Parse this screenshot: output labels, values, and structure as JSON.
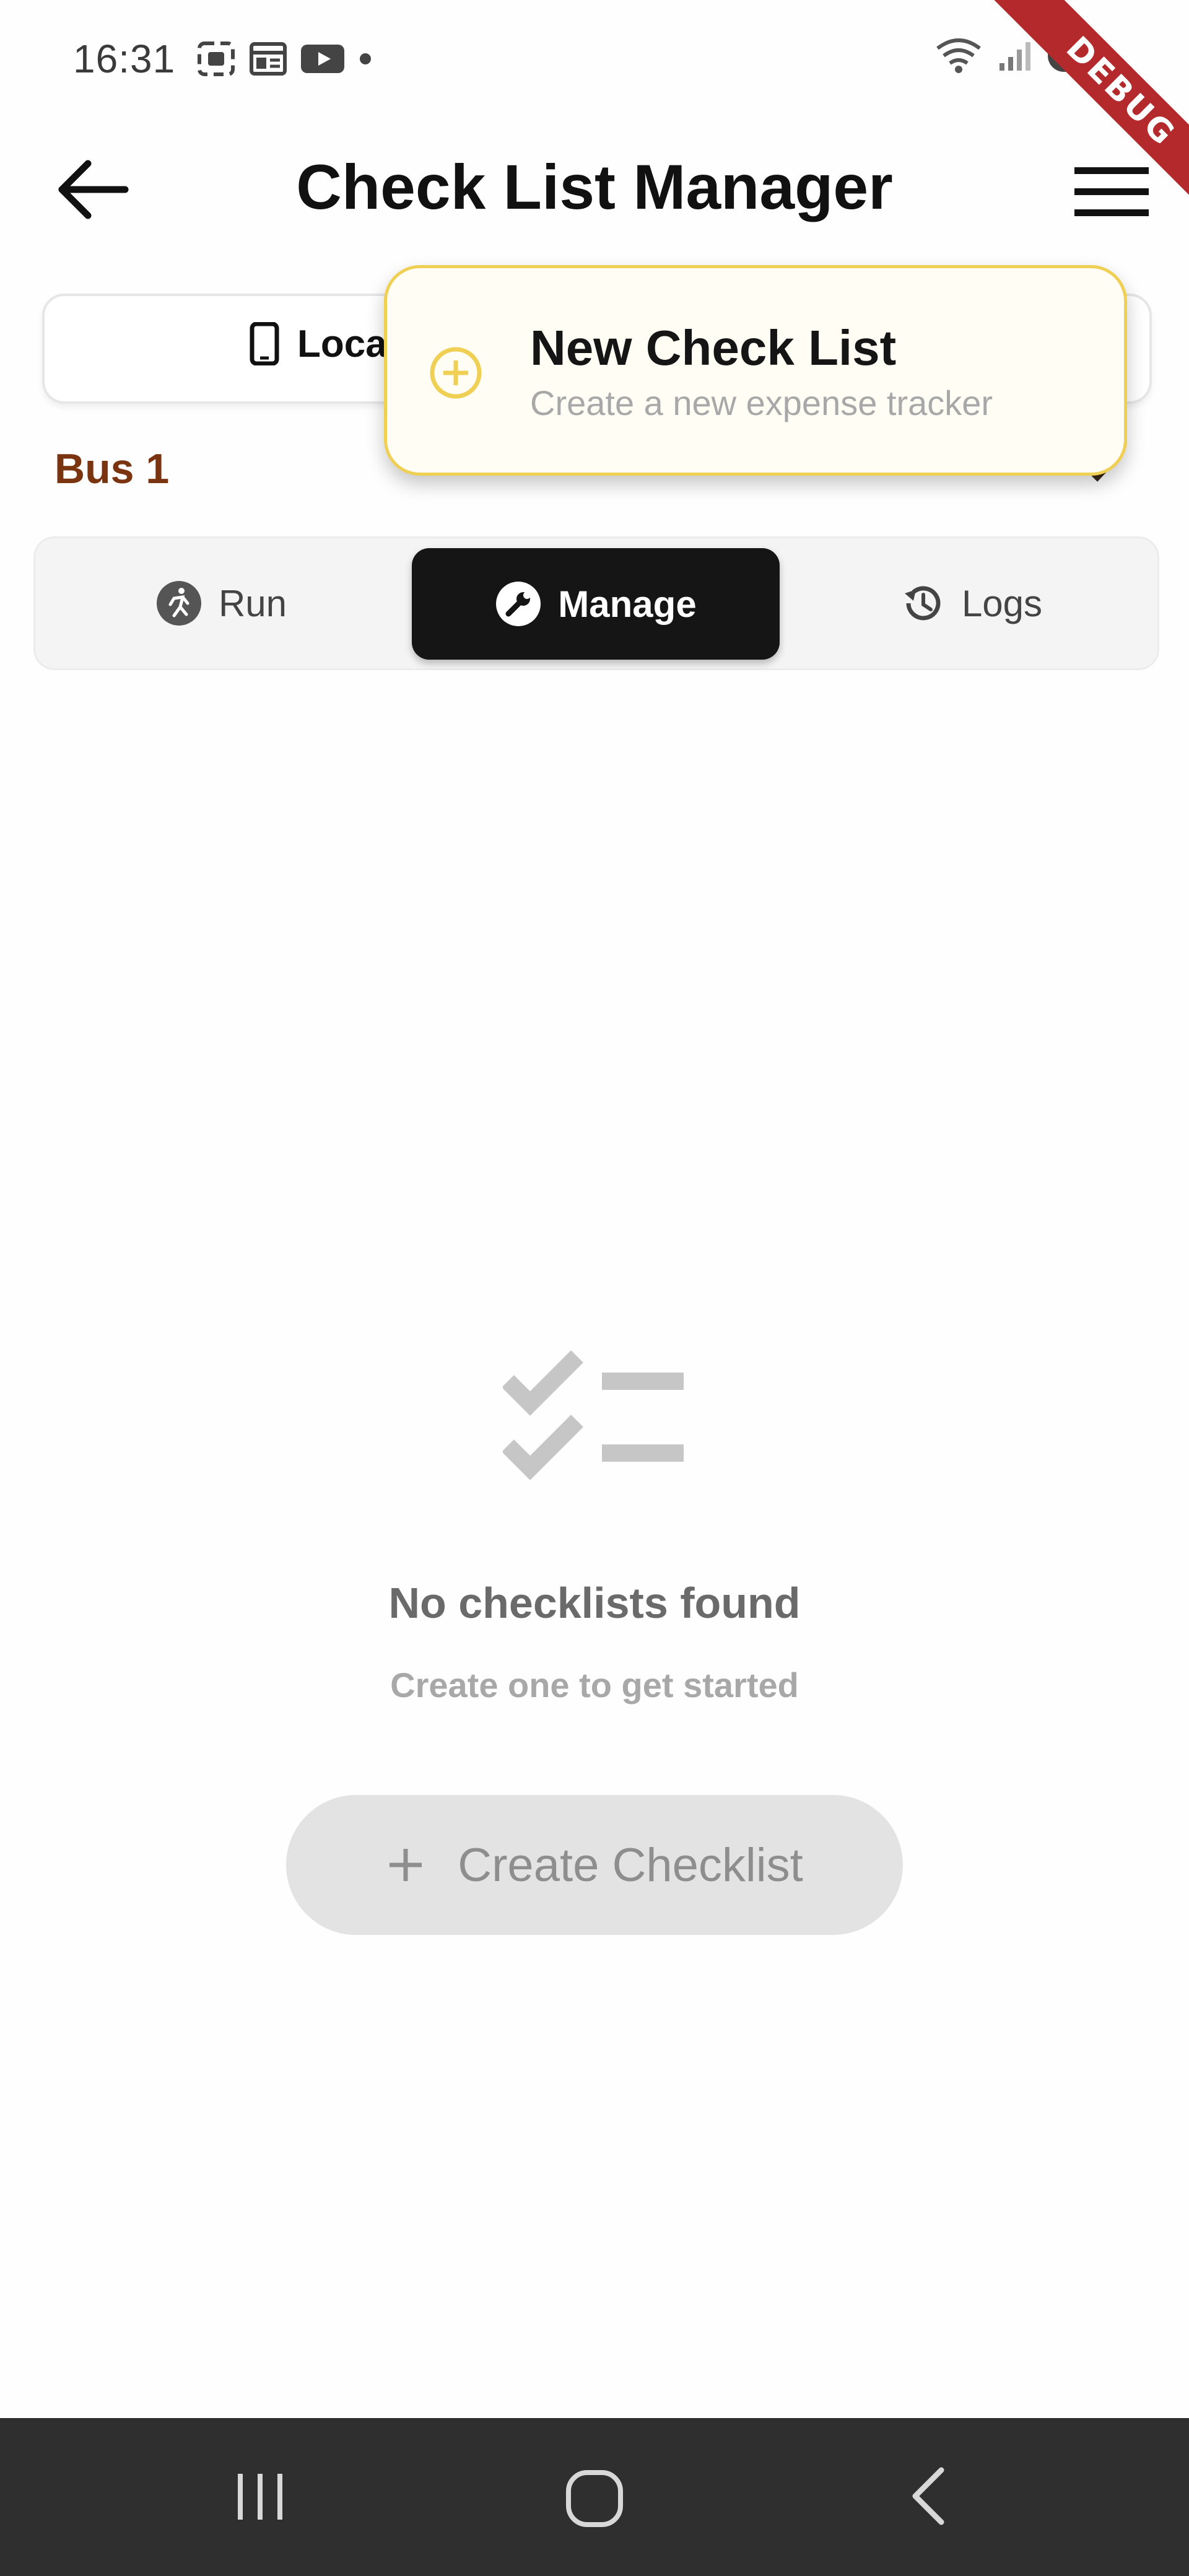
{
  "status_bar": {
    "time": "16:31",
    "icons": [
      "screenshot-icon",
      "gallery-icon",
      "youtube-icon",
      "dot-icon",
      "wifi-icon",
      "signal-icon",
      "battery-icon"
    ]
  },
  "debug_banner": "DEBUG",
  "app_bar": {
    "title": "Check List Manager",
    "back_icon": "arrow-left-icon",
    "menu_icon": "hamburger-icon"
  },
  "storage_selector": {
    "label": "Loca",
    "icon": "phone-icon"
  },
  "bus": {
    "name": "Bus 1"
  },
  "tabs": [
    {
      "label": "Run",
      "icon": "run-icon",
      "active": false
    },
    {
      "label": "Manage",
      "icon": "wrench-icon",
      "active": true
    },
    {
      "label": "Logs",
      "icon": "history-icon",
      "active": false
    }
  ],
  "popup_menu": {
    "title": "New Check List",
    "subtitle": "Create a new expense tracker",
    "icon": "add-circle-icon"
  },
  "empty_state": {
    "title": "No checklists found",
    "subtitle": "Create one to get started",
    "icon": "checklist-icon",
    "button_label": "Create Checklist"
  },
  "colors": {
    "accent_yellow": "#f0cf55",
    "bus_name": "#7a3410",
    "active_tab": "#151515",
    "nav_bar": "#2f2f2f"
  },
  "nav_bar": {
    "icons": [
      "recents-icon",
      "home-icon",
      "back-icon"
    ]
  }
}
